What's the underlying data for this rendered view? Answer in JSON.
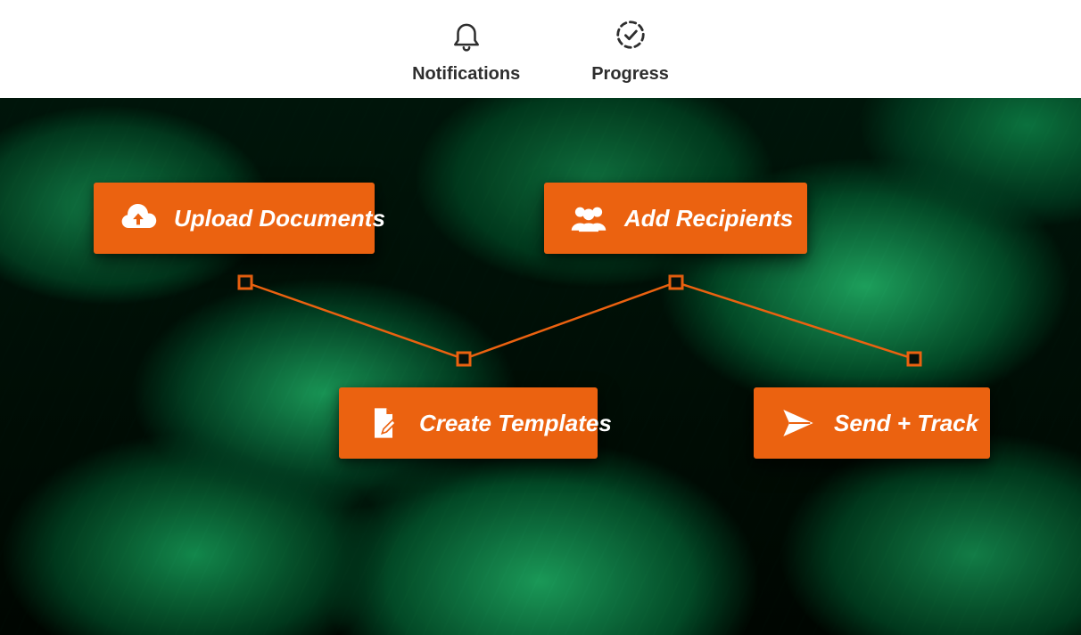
{
  "colors": {
    "accent": "#eb6210",
    "topbar_text": "#2e2e2e"
  },
  "topbar": {
    "notifications": {
      "label": "Notifications",
      "icon": "bell-icon"
    },
    "progress": {
      "label": "Progress",
      "icon": "progress-icon"
    }
  },
  "workflow": {
    "step1": {
      "label": "Upload Documents",
      "icon": "cloud-upload-icon"
    },
    "step2": {
      "label": "Create Templates",
      "icon": "doc-edit-icon"
    },
    "step3": {
      "label": "Add Recipients",
      "icon": "users-icon"
    },
    "step4": {
      "label": "Send + Track",
      "icon": "send-icon"
    }
  }
}
